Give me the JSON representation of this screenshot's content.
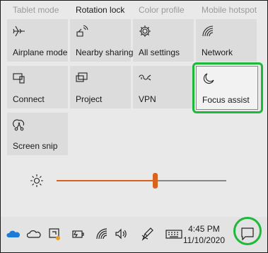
{
  "quick_actions": {
    "top_row": [
      {
        "label": "Tablet mode",
        "state": "off"
      },
      {
        "label": "Rotation lock",
        "state": "on"
      },
      {
        "label": "Color profile",
        "state": "off"
      },
      {
        "label": "Mobile hotspot",
        "state": "off"
      }
    ],
    "tiles": [
      {
        "label": "Airplane mode",
        "icon": "airplane-icon"
      },
      {
        "label": "Nearby sharing",
        "icon": "nearby-sharing-icon"
      },
      {
        "label": "All settings",
        "icon": "gear-icon"
      },
      {
        "label": "Network",
        "icon": "network-icon"
      },
      {
        "label": "Connect",
        "icon": "connect-icon"
      },
      {
        "label": "Project",
        "icon": "project-icon"
      },
      {
        "label": "VPN",
        "icon": "vpn-icon"
      },
      {
        "label": "Focus assist",
        "icon": "moon-icon"
      },
      {
        "label": "Screen snip",
        "icon": "screen-snip-icon"
      }
    ]
  },
  "brightness": {
    "level": 0.58,
    "icon": "sun-icon"
  },
  "taskbar": {
    "icons": [
      "onedrive-icon",
      "cloud-icon",
      "defender-icon",
      "battery-icon",
      "wifi-icon",
      "volume-icon",
      "pen-icon",
      "keyboard-icon"
    ],
    "time": "4:45 PM",
    "date": "11/10/2020",
    "notification_icon": "notification-center-icon"
  },
  "colors": {
    "highlight": "#1db93a",
    "accent": "#d9631e"
  }
}
